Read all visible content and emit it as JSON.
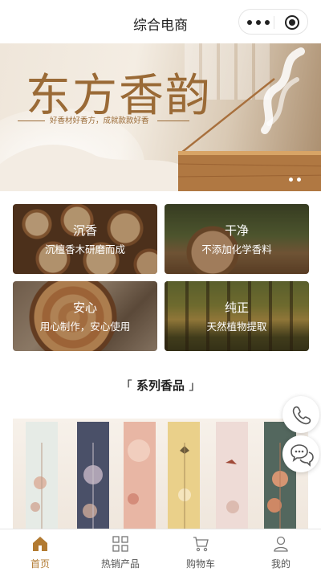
{
  "navbar": {
    "title": "综合电商"
  },
  "banner": {
    "title": "东方香韵",
    "subtitle": "好香材好香方，成就款款好香",
    "slide_count": 2,
    "active_slide": 1
  },
  "features": [
    {
      "title": "沉香",
      "subtitle": "沉檀香木研磨而成"
    },
    {
      "title": "干净",
      "subtitle": "不添加化学香料"
    },
    {
      "title": "安心",
      "subtitle": "用心制作，安心使用"
    },
    {
      "title": "纯正",
      "subtitle": "天然植物提取"
    }
  ],
  "section": {
    "bracket_left": "「",
    "title": "系列香品",
    "bracket_right": "」"
  },
  "floating": {
    "phone_icon": "phone-icon",
    "chat_icon": "chat-icon"
  },
  "tabbar": {
    "items": [
      {
        "label": "首页",
        "icon": "home-icon",
        "active": true
      },
      {
        "label": "热销产品",
        "icon": "grid-icon",
        "active": false
      },
      {
        "label": "购物车",
        "icon": "cart-icon",
        "active": false
      },
      {
        "label": "我的",
        "icon": "user-icon",
        "active": false
      }
    ]
  },
  "colors": {
    "accent": "#b27a31",
    "banner_text": "#9a6a36"
  }
}
